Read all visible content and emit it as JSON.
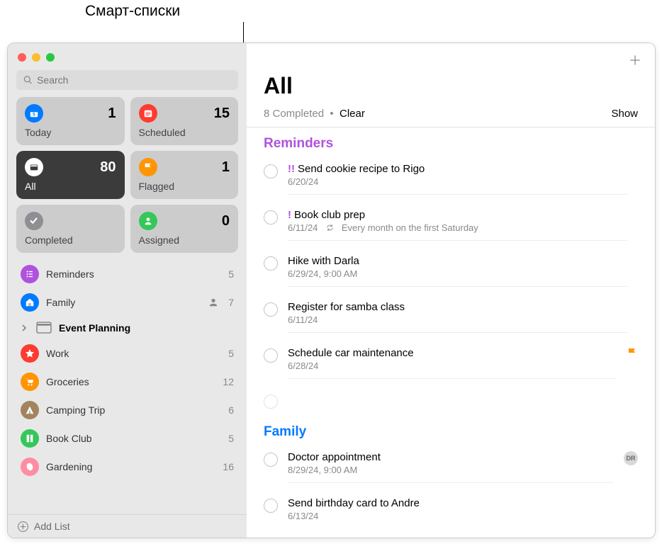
{
  "annotation": "Смарт-списки",
  "search": {
    "placeholder": "Search"
  },
  "smartLists": [
    {
      "id": "today",
      "label": "Today",
      "count": 1,
      "color": "#007aff"
    },
    {
      "id": "scheduled",
      "label": "Scheduled",
      "count": 15,
      "color": "#ff3b30"
    },
    {
      "id": "all",
      "label": "All",
      "count": 80,
      "color": "#ffffff",
      "active": true
    },
    {
      "id": "flagged",
      "label": "Flagged",
      "count": 1,
      "color": "#ff9500"
    },
    {
      "id": "completed",
      "label": "Completed",
      "count": "",
      "color": "#8e8e93"
    },
    {
      "id": "assigned",
      "label": "Assigned",
      "count": 0,
      "color": "#34c759"
    }
  ],
  "lists": [
    {
      "name": "Reminders",
      "count": 5,
      "color": "#af52de",
      "icon": "list"
    },
    {
      "name": "Family",
      "count": 7,
      "color": "#007aff",
      "icon": "home",
      "shared": true
    },
    {
      "name": "Event Planning",
      "group": true
    },
    {
      "name": "Work",
      "count": 5,
      "color": "#ff3b30",
      "icon": "star"
    },
    {
      "name": "Groceries",
      "count": 12,
      "color": "#ff9500",
      "icon": "cart"
    },
    {
      "name": "Camping Trip",
      "count": 6,
      "color": "#a2845e",
      "icon": "tent"
    },
    {
      "name": "Book Club",
      "count": 5,
      "color": "#34c759",
      "icon": "book"
    },
    {
      "name": "Gardening",
      "count": 16,
      "color": "#ff8da1",
      "icon": "leaf"
    }
  ],
  "addList": "Add List",
  "main": {
    "title": "All",
    "completedText": "8 Completed",
    "clearLabel": "Clear",
    "showLabel": "Show",
    "sections": [
      {
        "name": "Reminders",
        "class": "reminders",
        "items": [
          {
            "priority": "!!",
            "title": "Send cookie recipe to Rigo",
            "date": "6/20/24"
          },
          {
            "priority": "!",
            "title": "Book club prep",
            "date": "6/11/24",
            "repeat": "Every month on the first Saturday"
          },
          {
            "title": "Hike with Darla",
            "date": "6/29/24, 9:00 AM"
          },
          {
            "title": "Register for samba class",
            "date": "6/11/24"
          },
          {
            "title": "Schedule car maintenance",
            "date": "6/28/24",
            "flagged": true
          }
        ]
      },
      {
        "name": "Family",
        "class": "family",
        "items": [
          {
            "title": "Doctor appointment",
            "date": "8/29/24, 9:00 AM",
            "avatar": "DR"
          },
          {
            "title": "Send birthday card to Andre",
            "date": "6/13/24"
          }
        ]
      }
    ]
  }
}
